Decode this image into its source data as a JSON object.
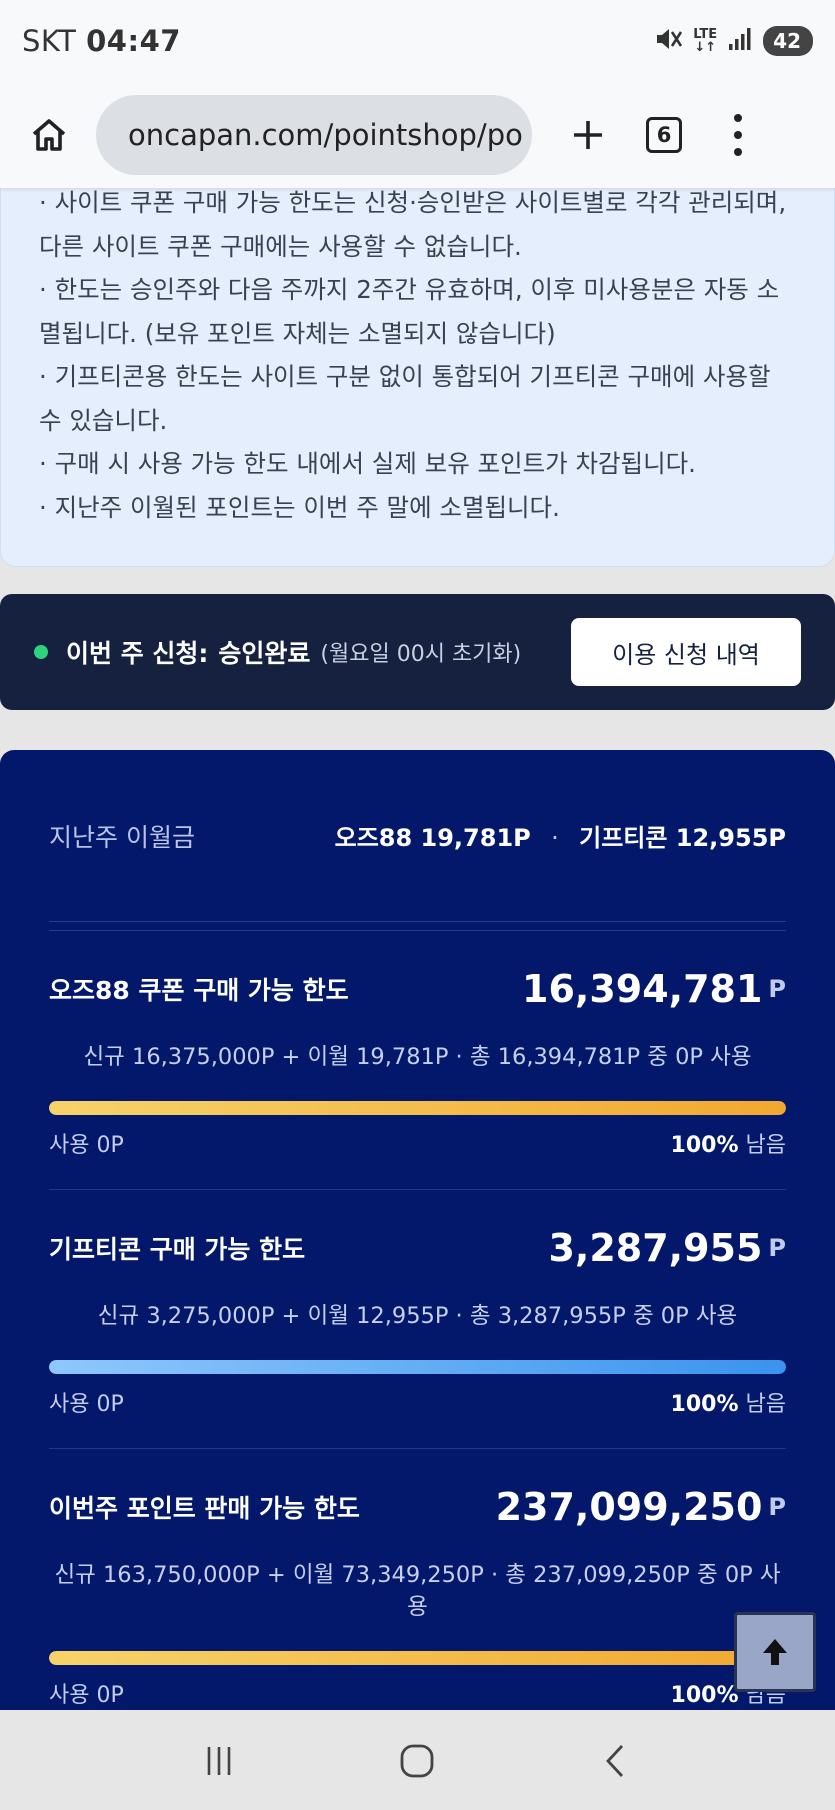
{
  "status_bar": {
    "carrier": "SKT",
    "time": "04:47",
    "network": "LTE",
    "battery": "42"
  },
  "browser": {
    "url": "oncapan.com/pointshop/po",
    "tab_count": "6"
  },
  "notice": {
    "lines": [
      "· 사이트 쿠폰 구매 가능 한도는 신청·승인받은 사이트별로 각각 관리되며,",
      "다른 사이트 쿠폰 구매에는 사용할 수 없습니다.",
      "· 한도는 승인주와 다음 주까지 2주간 유효하며, 이후 미사용분은 자동 소",
      "멸됩니다. (보유 포인트 자체는 소멸되지 않습니다)",
      "· 기프티콘용 한도는 사이트 구분 없이 통합되어 기프티콘 구매에 사용할",
      "수 있습니다.",
      "· 구매 시 사용 가능 한도 내에서 실제 보유 포인트가 차감됩니다.",
      "· 지난주 이월된 포인트는 이번 주 말에 소멸됩니다."
    ]
  },
  "weekly_status": {
    "label": "이번 주 신청:",
    "value": "승인완료",
    "note": "(월요일 00시 초기화)",
    "history_button": "이용 신청 내역",
    "indicator_color": "#2ed17c"
  },
  "carryover": {
    "label": "지난주 이월금",
    "oz88": "오즈88 19,781P",
    "separator": "·",
    "gifticon": "기프티콘 12,955P"
  },
  "limits": [
    {
      "title": "오즈88 쿠폰 구매 가능 한도",
      "amount": "16,394,781",
      "unit": "P",
      "detail": "신규 16,375,000P + 이월 19,781P · 총 16,394,781P 중 0P 사용",
      "used": "사용 0P",
      "remain_pct": "100%",
      "remain_word": "남음",
      "remaining_fraction": 1.0
    },
    {
      "title": "기프티콘 구매 가능 한도",
      "amount": "3,287,955",
      "unit": "P",
      "detail": "신규 3,275,000P + 이월 12,955P · 총 3,287,955P 중 0P 사용",
      "used": "사용 0P",
      "remain_pct": "100%",
      "remain_word": "남음",
      "remaining_fraction": 1.0
    },
    {
      "title": "이번주 포인트 판매 가능 한도",
      "amount": "237,099,250",
      "unit": "P",
      "detail": "신규 163,750,000P + 이월 73,349,250P · 총 237,099,250P 중 0P 사용",
      "used": "사용 0P",
      "remain_pct": "100%",
      "remain_word": "남음",
      "remaining_fraction": 1.0
    }
  ],
  "colors": {
    "panel_bg": "#03186b",
    "status_bg": "#15213f",
    "notice_bg": "#e4eefc",
    "gold_bar": "#f2a82f",
    "blue_bar": "#3a93ee"
  }
}
